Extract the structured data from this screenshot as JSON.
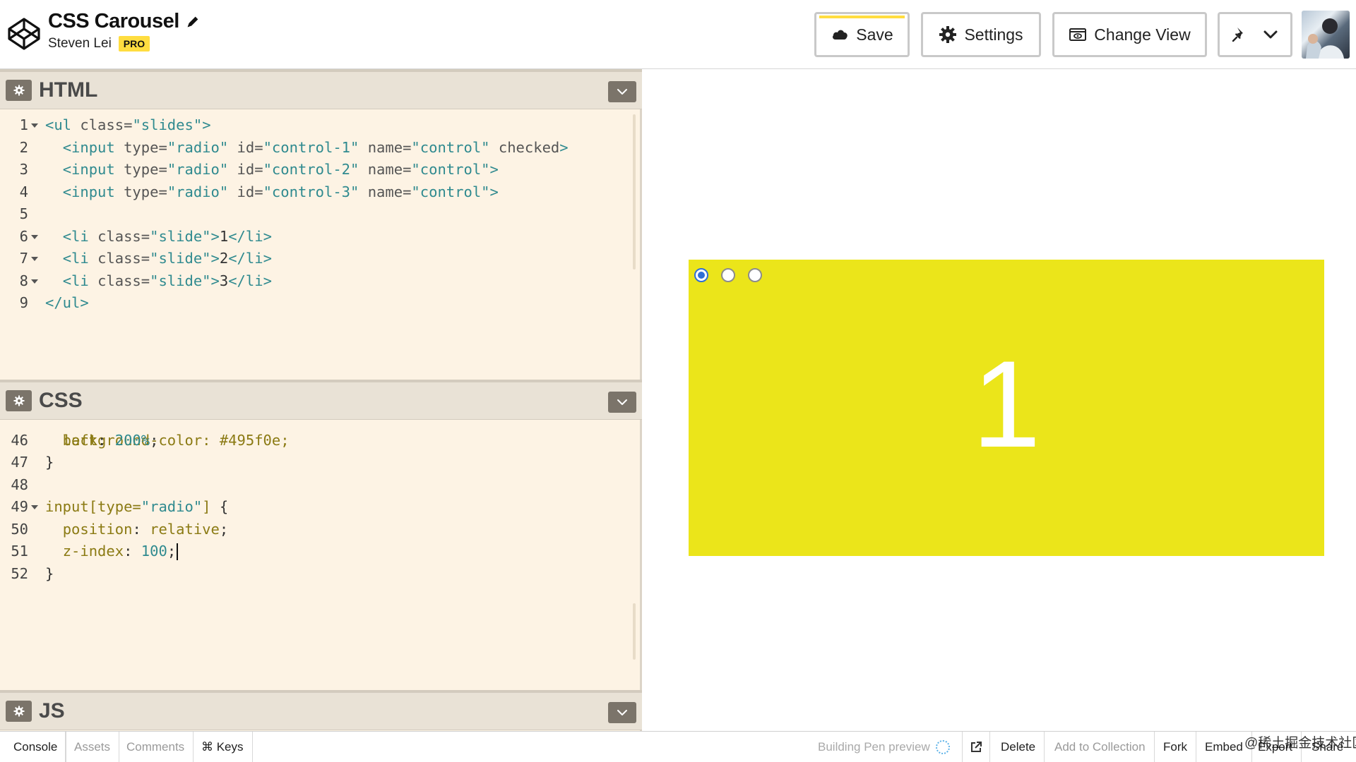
{
  "header": {
    "pen_title": "CSS Carousel",
    "owner_name": "Steven Lei",
    "badge": "PRO",
    "buttons": {
      "save": "Save",
      "settings": "Settings",
      "change_view": "Change View"
    },
    "accent_color": "#ffdd40"
  },
  "html_panel": {
    "name": "HTML",
    "lines": [
      {
        "n": "1",
        "fold": true,
        "parts": [
          [
            "t-tag",
            "<ul "
          ],
          [
            "t-attr",
            "class="
          ],
          [
            "t-str",
            "\"slides\""
          ],
          [
            "t-tag",
            ">"
          ]
        ]
      },
      {
        "n": "2",
        "fold": false,
        "parts": [
          [
            "t-text",
            "  "
          ],
          [
            "t-tag",
            "<input "
          ],
          [
            "t-attr",
            "type="
          ],
          [
            "t-str",
            "\"radio\""
          ],
          [
            "t-attr",
            " id="
          ],
          [
            "t-str",
            "\"control-1\""
          ],
          [
            "t-attr",
            " name="
          ],
          [
            "t-str",
            "\"control\""
          ],
          [
            "t-attr",
            " checked"
          ],
          [
            "t-tag",
            ">"
          ]
        ]
      },
      {
        "n": "3",
        "fold": false,
        "parts": [
          [
            "t-text",
            "  "
          ],
          [
            "t-tag",
            "<input "
          ],
          [
            "t-attr",
            "type="
          ],
          [
            "t-str",
            "\"radio\""
          ],
          [
            "t-attr",
            " id="
          ],
          [
            "t-str",
            "\"control-2\""
          ],
          [
            "t-attr",
            " name="
          ],
          [
            "t-str",
            "\"control\""
          ],
          [
            "t-tag",
            ">"
          ]
        ]
      },
      {
        "n": "4",
        "fold": false,
        "parts": [
          [
            "t-text",
            "  "
          ],
          [
            "t-tag",
            "<input "
          ],
          [
            "t-attr",
            "type="
          ],
          [
            "t-str",
            "\"radio\""
          ],
          [
            "t-attr",
            " id="
          ],
          [
            "t-str",
            "\"control-3\""
          ],
          [
            "t-attr",
            " name="
          ],
          [
            "t-str",
            "\"control\""
          ],
          [
            "t-tag",
            ">"
          ]
        ]
      },
      {
        "n": "5",
        "fold": false,
        "parts": []
      },
      {
        "n": "6",
        "fold": true,
        "parts": [
          [
            "t-text",
            "  "
          ],
          [
            "t-tag",
            "<li "
          ],
          [
            "t-attr",
            "class="
          ],
          [
            "t-str",
            "\"slide\""
          ],
          [
            "t-tag",
            ">"
          ],
          [
            "t-text",
            "1"
          ],
          [
            "t-tag",
            "</li>"
          ]
        ]
      },
      {
        "n": "7",
        "fold": true,
        "parts": [
          [
            "t-text",
            "  "
          ],
          [
            "t-tag",
            "<li "
          ],
          [
            "t-attr",
            "class="
          ],
          [
            "t-str",
            "\"slide\""
          ],
          [
            "t-tag",
            ">"
          ],
          [
            "t-text",
            "2"
          ],
          [
            "t-tag",
            "</li>"
          ]
        ]
      },
      {
        "n": "8",
        "fold": true,
        "parts": [
          [
            "t-text",
            "  "
          ],
          [
            "t-tag",
            "<li "
          ],
          [
            "t-attr",
            "class="
          ],
          [
            "t-str",
            "\"slide\""
          ],
          [
            "t-tag",
            ">"
          ],
          [
            "t-text",
            "3"
          ],
          [
            "t-tag",
            "</li>"
          ]
        ]
      },
      {
        "n": "9",
        "fold": false,
        "parts": [
          [
            "t-tag",
            "</ul>"
          ]
        ]
      }
    ]
  },
  "css_panel": {
    "name": "CSS",
    "partial_line": "  background-color: #495f0e;",
    "lines": [
      {
        "n": "46",
        "fold": false,
        "parts": [
          [
            "t-text",
            "  "
          ],
          [
            "t-prop",
            "left"
          ],
          [
            "t-text",
            ": "
          ],
          [
            "t-val",
            "200%"
          ],
          [
            "t-text",
            ";"
          ]
        ]
      },
      {
        "n": "47",
        "fold": false,
        "parts": [
          [
            "t-text",
            "}"
          ]
        ]
      },
      {
        "n": "48",
        "fold": false,
        "parts": []
      },
      {
        "n": "49",
        "fold": true,
        "parts": [
          [
            "t-sel",
            "input[type="
          ],
          [
            "t-str",
            "\"radio\""
          ],
          [
            "t-sel",
            "]"
          ],
          [
            "t-text",
            " {"
          ]
        ]
      },
      {
        "n": "50",
        "fold": false,
        "parts": [
          [
            "t-text",
            "  "
          ],
          [
            "t-prop",
            "position"
          ],
          [
            "t-text",
            ": "
          ],
          [
            "t-prop",
            "relative"
          ],
          [
            "t-text",
            ";"
          ]
        ]
      },
      {
        "n": "51",
        "fold": false,
        "cursor": true,
        "parts": [
          [
            "t-text",
            "  "
          ],
          [
            "t-prop",
            "z-index"
          ],
          [
            "t-text",
            ": "
          ],
          [
            "t-val",
            "100"
          ],
          [
            "t-text",
            ";"
          ]
        ]
      },
      {
        "n": "52",
        "fold": false,
        "parts": [
          [
            "t-text",
            "}"
          ]
        ]
      }
    ]
  },
  "js_panel": {
    "name": "JS"
  },
  "preview": {
    "slide_text": "1",
    "slide_color": "#ebe51a",
    "radios": [
      true,
      false,
      false
    ]
  },
  "footer": {
    "console": "Console",
    "assets": "Assets",
    "comments": "Comments",
    "keys": "⌘ Keys",
    "status": "Building Pen preview",
    "delete": "Delete",
    "add_to_collection": "Add to Collection",
    "fork": "Fork",
    "embed": "Embed",
    "export": "Export",
    "share": "Share",
    "watermark": "@稀土掘金技术社区"
  }
}
